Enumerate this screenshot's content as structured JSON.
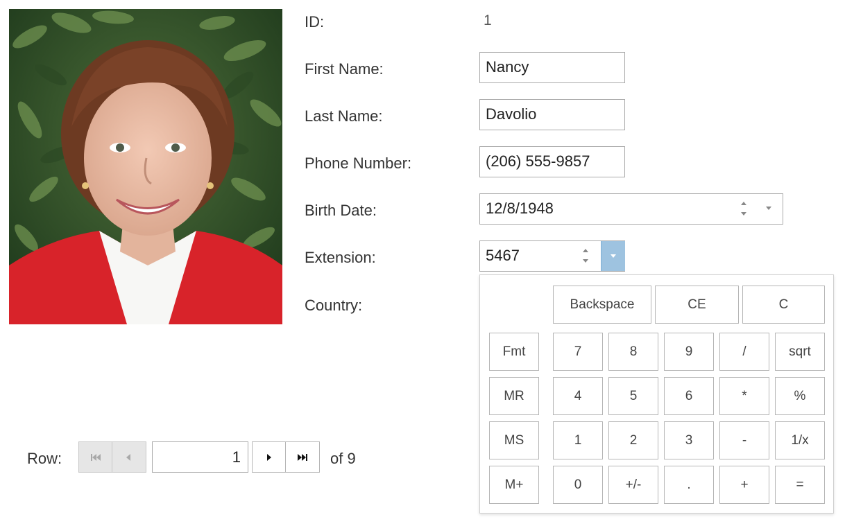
{
  "form": {
    "id_label": "ID:",
    "id_value": "1",
    "first_name_label": "First Name:",
    "first_name_value": "Nancy",
    "last_name_label": "Last Name:",
    "last_name_value": "Davolio",
    "phone_label": "Phone Number:",
    "phone_value": "(206) 555-9857",
    "birth_date_label": "Birth Date:",
    "birth_date_value": "12/8/1948",
    "extension_label": "Extension:",
    "extension_value": "5467",
    "country_label": "Country:"
  },
  "calculator": {
    "top_row": [
      "Backspace",
      "CE",
      "C"
    ],
    "memory": [
      "Fmt",
      "MR",
      "MS",
      "M+"
    ],
    "keys": [
      [
        "7",
        "8",
        "9",
        "/",
        "sqrt"
      ],
      [
        "4",
        "5",
        "6",
        "*",
        "%"
      ],
      [
        "1",
        "2",
        "3",
        "-",
        "1/x"
      ],
      [
        "0",
        "+/-",
        ".",
        "+",
        "="
      ]
    ]
  },
  "pager": {
    "row_label": "Row:",
    "current_page": "1",
    "of_label": "of 9"
  },
  "colors": {
    "accent": "#9ec3e0",
    "border": "#a9a9a9",
    "disabled_bg": "#e6e6e6"
  },
  "icons": {
    "photo": "employee-photo",
    "first": "first-page-icon",
    "prev": "prev-page-icon",
    "next": "next-page-icon",
    "last": "last-page-icon"
  }
}
